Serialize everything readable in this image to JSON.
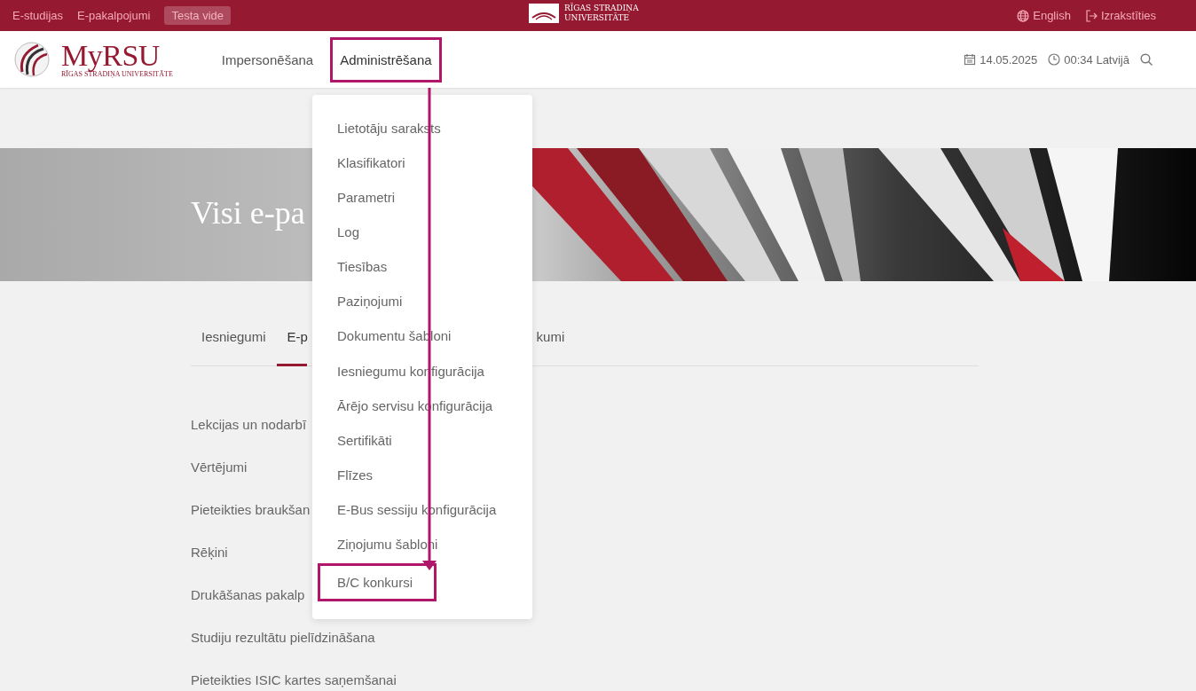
{
  "top_bar": {
    "links": [
      "E-studijas",
      "E-pakalpojumi"
    ],
    "environment_badge": "Testa vide",
    "university_name": [
      "RĪGAS STRADIŅA",
      "UNIVERSITĀTE"
    ],
    "language": "English",
    "logout": "Izrakstīties"
  },
  "header": {
    "logo_text": "MyRSU",
    "logo_subtitle": "RĪGAS STRADIŅA UNIVERSITĀTE",
    "nav": [
      {
        "label": "Impersonēšana",
        "selected": false,
        "highlighted": false
      },
      {
        "label": "Administrēšana",
        "selected": true,
        "highlighted": true
      }
    ],
    "date": "14.05.2025",
    "time": "00:34 Latvijā"
  },
  "dropdown": {
    "items": [
      {
        "label": "Lietotāju saraksts",
        "highlighted": false
      },
      {
        "label": "Klasifikatori",
        "highlighted": false
      },
      {
        "label": "Parametri",
        "highlighted": false
      },
      {
        "label": "Log",
        "highlighted": false
      },
      {
        "label": "Tiesības",
        "highlighted": false
      },
      {
        "label": "Paziņojumi",
        "highlighted": false
      },
      {
        "label": "Dokumentu šabloni",
        "highlighted": false
      },
      {
        "label": "Iesniegumu konfigurācija",
        "highlighted": false
      },
      {
        "label": "Ārējo servisu konfigurācija",
        "highlighted": false
      },
      {
        "label": "Sertifikāti",
        "highlighted": false
      },
      {
        "label": "Flīzes",
        "highlighted": false
      },
      {
        "label": "E-Bus sessiju konfigurācija",
        "highlighted": false
      },
      {
        "label": "Ziņojumu šabloni",
        "highlighted": false
      },
      {
        "label": "B/C konkursi",
        "highlighted": true
      }
    ]
  },
  "hero": {
    "title": "Visi e-pa"
  },
  "tabs": [
    {
      "label": "Iesniegumi",
      "selected": false
    },
    {
      "label": "E-p",
      "selected": true
    },
    {
      "label": "kumi",
      "selected": false
    }
  ],
  "services": [
    "Lekcijas un nodarbī",
    "Vērtējumi",
    "Pieteikties braukšan",
    "Rēķini",
    "Drukāšanas pakalp",
    "Studiju rezultātu pielīdzināšana",
    "Pieteikties ISIC kartes saņemšanai"
  ],
  "annotations": {
    "arrow": true
  }
}
